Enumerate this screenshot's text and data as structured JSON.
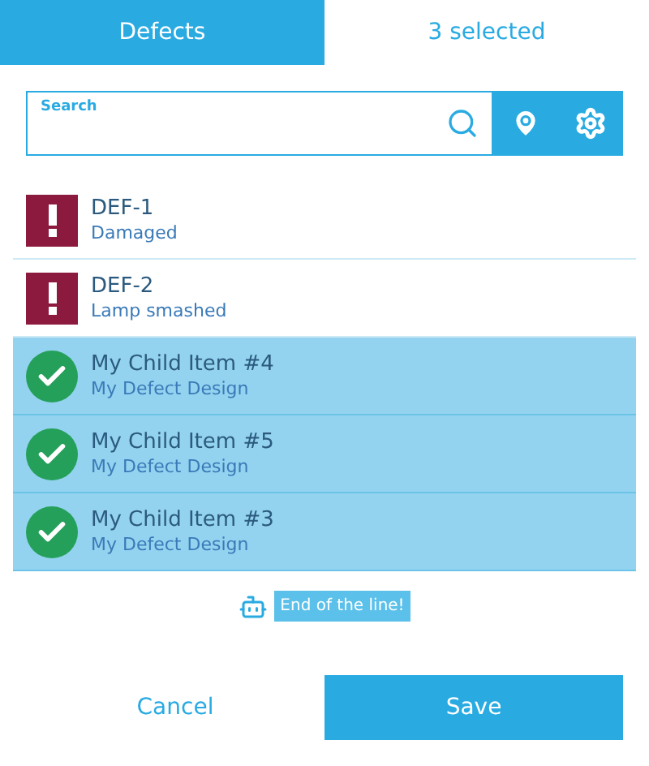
{
  "tabs": [
    {
      "label": "Defects",
      "selected": true
    },
    {
      "label": "3 selected",
      "selected": false
    }
  ],
  "search": {
    "label": "Search"
  },
  "items": [
    {
      "kind": "defect",
      "title": "DEF-1",
      "subtitle": "Damaged",
      "selected": false
    },
    {
      "kind": "defect",
      "title": "DEF-2",
      "subtitle": "Lamp smashed",
      "selected": false
    },
    {
      "kind": "item",
      "title": "My Child Item #4",
      "subtitle": "My Defect Design",
      "selected": true
    },
    {
      "kind": "item",
      "title": "My Child Item #5",
      "subtitle": "My Defect Design",
      "selected": true
    },
    {
      "kind": "item",
      "title": "My Child Item #3",
      "subtitle": "My Defect Design",
      "selected": true
    }
  ],
  "end_message": "End of the line!",
  "buttons": {
    "cancel": "Cancel",
    "save": "Save"
  }
}
